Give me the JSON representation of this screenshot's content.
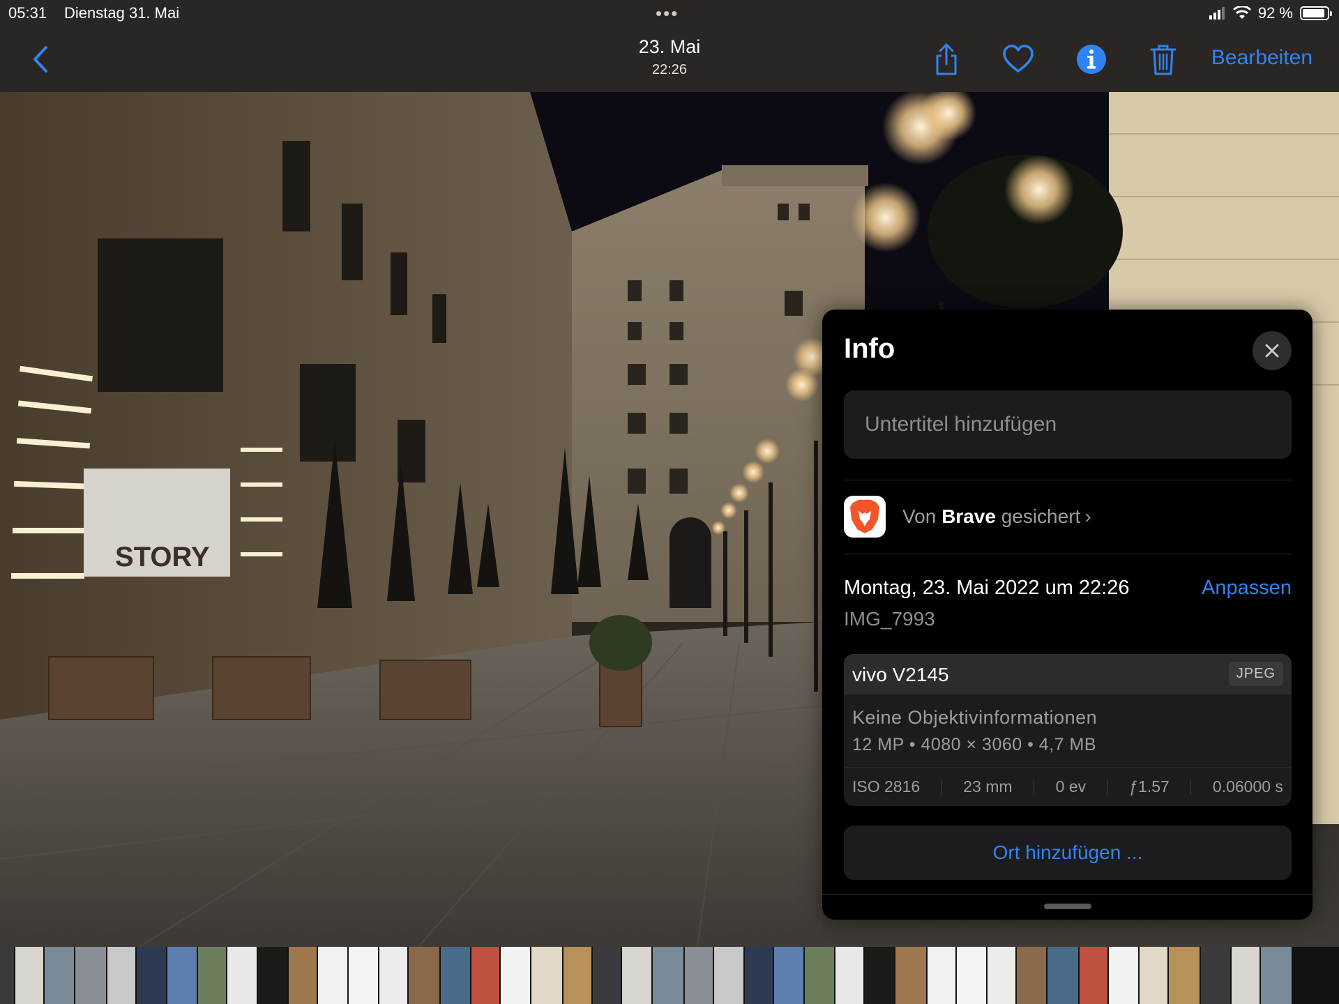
{
  "status_bar": {
    "time": "05:31",
    "date": "Dienstag 31. Mai",
    "multitask_dots": "•••",
    "battery_text": "92 %",
    "battery_level": 0.92
  },
  "nav": {
    "title": "23. Mai",
    "subtitle": "22:26",
    "edit_label": "Bearbeiten",
    "icons": [
      "back-chevron-icon",
      "share-icon",
      "heart-icon",
      "info-icon",
      "trash-icon"
    ]
  },
  "photo": {
    "storefront_sign": "STORY"
  },
  "info_panel": {
    "title": "Info",
    "caption_placeholder": "Untertitel hinzufügen",
    "source_prefix": "Von",
    "source_app": "Brave",
    "source_suffix": "gesichert",
    "source_chevron": "›",
    "datetime": "Montag, 23. Mai 2022 um 22:26",
    "adjust_label": "Anpassen",
    "filename": "IMG_7993",
    "camera": {
      "model": "vivo V2145",
      "format": "JPEG",
      "lens": "Keine Objektivinformationen",
      "specs": "12 MP  •  4080 × 3060  •  4,7 MB",
      "exif": [
        "ISO 2816",
        "23 mm",
        "0 ev",
        "ƒ1.57",
        "0.06000 s"
      ]
    },
    "location_label": "Ort hinzufügen ..."
  },
  "colors": {
    "accent": "#2f84f3",
    "bar_bg": "#2a2623",
    "panel_bg": "#000000",
    "card_bg": "#1c1c1e"
  }
}
